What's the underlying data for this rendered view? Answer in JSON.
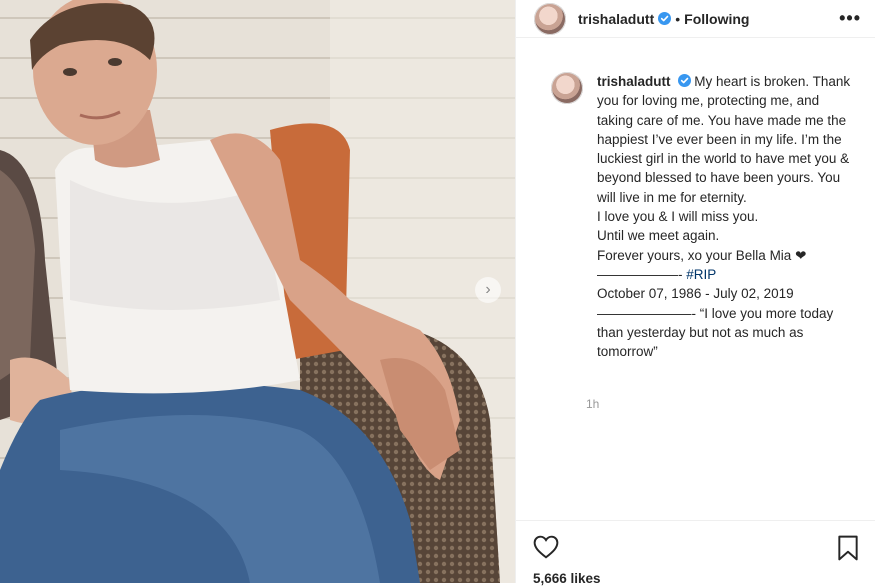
{
  "post": {
    "username": "trishaladutt",
    "separator": "•",
    "follow_status": "Following",
    "more_label": "•••",
    "next_label": "›"
  },
  "caption": {
    "lines": [
      "My heart is broken.",
      "Thank you for loving me, protecting me, and taking care of me. You have made me the happiest I’ve ever been in my life. I’m the luckiest girl in the world to have met you & beyond blessed to have been yours. You will live in me for eternity.",
      "I love you & I will miss you.",
      "Until we meet again.",
      "Forever yours, xo your Bella Mia ❤",
      "——————-",
      "#RIP",
      "October 07, 1986 - July 02, 2019",
      "———————- “I love you more today than yesterday but not as much as tomorrow”"
    ]
  },
  "meta": {
    "time": "1h",
    "likes": "5,666 likes"
  },
  "colors": {
    "verified": "#3897f0",
    "hashtag": "#003569",
    "muted": "#999999"
  }
}
